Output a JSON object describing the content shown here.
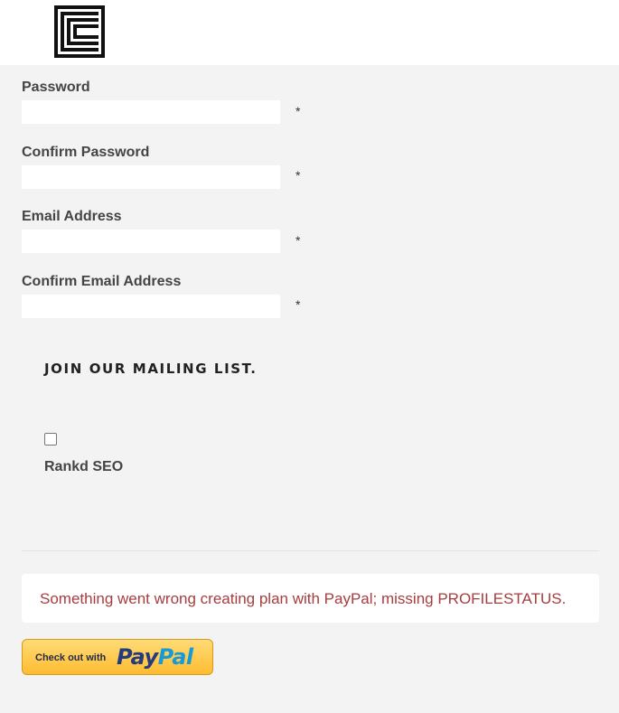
{
  "header": {
    "logo_icon": "square-maze-logo-icon"
  },
  "form": {
    "fields": [
      {
        "label": "Password",
        "value": "",
        "required_mark": "*"
      },
      {
        "label": "Confirm Password",
        "value": "",
        "required_mark": "*"
      },
      {
        "label": "Email Address",
        "value": "",
        "required_mark": "*"
      },
      {
        "label": "Confirm Email Address",
        "value": "",
        "required_mark": "*"
      }
    ]
  },
  "mailing": {
    "heading": "JOIN OUR MAILING LIST.",
    "list_name": "Rankd SEO",
    "checked": false
  },
  "error": {
    "message": "Something went wrong creating plan with PayPal; missing PROFILESTATUS.",
    "color": "#a63d40"
  },
  "paypal": {
    "checkout_text": "Check out with",
    "brand_pay": "Pay",
    "brand_pal": "Pal"
  }
}
